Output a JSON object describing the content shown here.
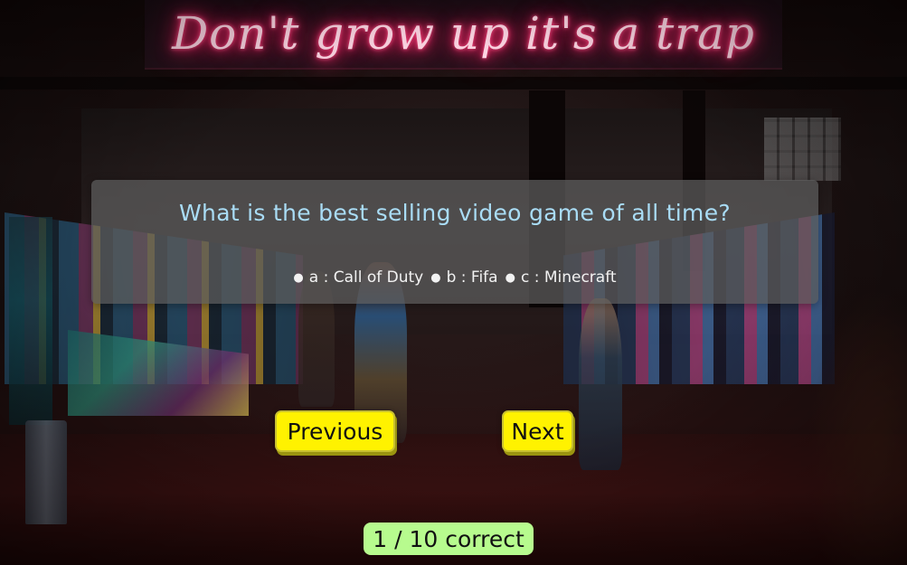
{
  "neon_sign": {
    "text": "Don't grow up it's a trap"
  },
  "quiz": {
    "question": "What is the best selling video game of all time?",
    "options": [
      {
        "key": "a",
        "label": "a : Call of Duty"
      },
      {
        "key": "b",
        "label": "b : Fifa"
      },
      {
        "key": "c",
        "label": "c : Minecraft"
      }
    ],
    "bullet": "●"
  },
  "navigation": {
    "previous_label": "Previous",
    "next_label": "Next"
  },
  "score": {
    "text": "1 / 10 correct",
    "correct": 1,
    "total": 10
  },
  "colors": {
    "question_text": "#a9dcf5",
    "button_bg": "#fff200",
    "score_bg": "#b7fb8e",
    "neon": "#ff2a6d"
  }
}
